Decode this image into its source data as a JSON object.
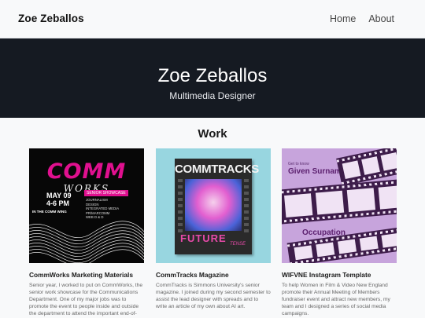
{
  "header": {
    "brand": "Zoe Zeballos",
    "nav": [
      "Home",
      "About"
    ]
  },
  "hero": {
    "title": "Zoe Zeballos",
    "subtitle": "Multimedia Designer"
  },
  "work": {
    "heading": "Work",
    "cards": [
      {
        "title": "CommWorks Marketing Materials",
        "desc": "Senior year, I worked to put on CommWorks, the senior work showcase for the Communications Department. One of my major jobs was to promote the event to people inside and outside the department to attend the important end-of-year event.",
        "thumb": {
          "big": "COMM",
          "small": "WORKS",
          "date": "MAY 09",
          "time": "4-6 PM",
          "badge": "SENIOR SHOWCASE",
          "place": "IN THE COMM WING",
          "list": [
            "journalism",
            "design",
            "integrated media",
            "pr/marcomm",
            "web d & d"
          ]
        }
      },
      {
        "title": "CommTracks Magazine",
        "desc": "CommTracks is Simmons University's senior magazine. I joined during my second semester to assist the lead designer with spreads and to write an article of my own about AI art.",
        "thumb": {
          "title": "COMMTRACKS",
          "future": "FUTURE",
          "tense": "TENSE"
        }
      },
      {
        "title": "WIFVNE Instagram Template",
        "desc": "To help Women in Film & Video New England promote their Annual Meeting of Members fundraiser event and attract new members, my team and I designed a series of social media campaigns.",
        "thumb": {
          "kicker": "Get to know",
          "name": "Given Surname",
          "role": "Occupation"
        }
      }
    ]
  },
  "colors": {
    "hero_bg": "#151a22",
    "nav_bg": "#f8f9fa",
    "accent_pink": "#e0108f",
    "mag_bg": "#98d6e0",
    "wif_bg": "#c7a4dc"
  }
}
